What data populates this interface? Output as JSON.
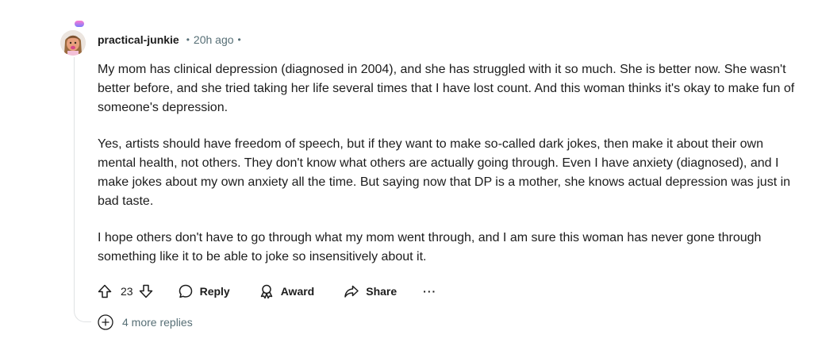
{
  "comment": {
    "username": "practical-junkie",
    "separator": "•",
    "timestamp": "20h ago",
    "trailing_dot": "•",
    "paragraphs": [
      "My mom has clinical depression (diagnosed in 2004), and she has struggled with it so much. She is better now. She wasn't better before, and she tried taking her life several times that I have lost count. And this woman thinks it's okay to make fun of someone's depression.",
      "Yes, artists should have freedom of speech, but if they want to make so-called dark jokes, then make it about their own mental health, not others. They don't know what others are actually going through. Even I have anxiety (diagnosed), and I make jokes about my own anxiety all the time. But saying now that DP is a mother, she knows actual depression was just in bad taste.",
      "I hope others don't have to go through what my mom went through, and I am sure this woman has never gone through something like it to be able to joke so insensitively about it."
    ],
    "actions": {
      "vote_count": "23",
      "reply_label": "Reply",
      "award_label": "Award",
      "share_label": "Share",
      "more_label": "···"
    },
    "more_replies_label": "4 more replies"
  },
  "icons": {
    "avatar": "avatar-icon",
    "upvote": "arrow-up-icon",
    "downvote": "arrow-down-icon",
    "reply": "speech-bubble-icon",
    "award": "award-icon",
    "share": "share-icon",
    "more": "ellipsis-icon",
    "expand": "plus-circle-icon"
  },
  "colors": {
    "text": "#1c1c1c",
    "meta": "#576f76",
    "thread_line": "#e0e2e4"
  }
}
